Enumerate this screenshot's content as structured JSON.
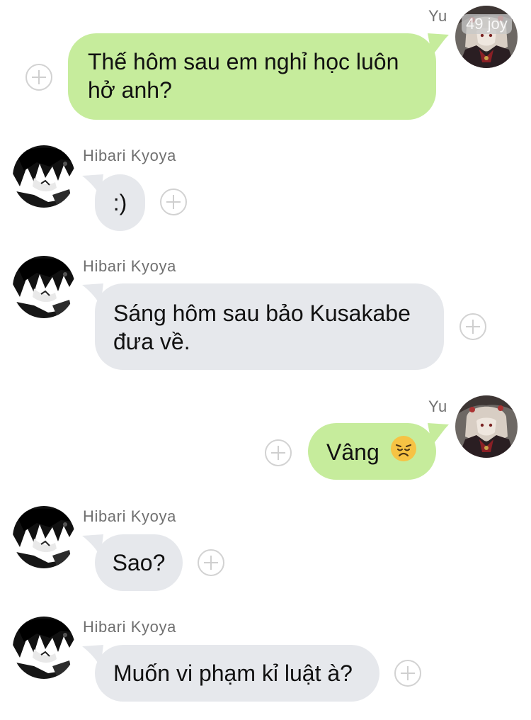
{
  "messages": [
    {
      "sender": "Yu",
      "side": "right",
      "text": "Thế hôm sau em nghỉ học luôn hở anh?",
      "badge": "49 joy"
    },
    {
      "sender": "Hibari Kyoya",
      "side": "left",
      "text": ":)"
    },
    {
      "sender": "Hibari Kyoya",
      "side": "left",
      "text": "Sáng hôm sau bảo Kusakabe đưa về."
    },
    {
      "sender": "Yu",
      "side": "right",
      "text": "Vâng",
      "emoji": "😞"
    },
    {
      "sender": "Hibari Kyoya",
      "side": "left",
      "text": "Sao?"
    },
    {
      "sender": "Hibari Kyoya",
      "side": "left",
      "text": "Muốn vi phạm kỉ luật à?"
    }
  ],
  "icons": {
    "add_reaction": "plus-circle-icon",
    "avatar_yu": "avatar-yu",
    "avatar_hibari": "avatar-hibari-kyoya"
  },
  "colors": {
    "sent_bubble": "#c6ec9c",
    "received_bubble": "#e6e8ec",
    "name_text": "#707070",
    "message_text": "#111111"
  }
}
